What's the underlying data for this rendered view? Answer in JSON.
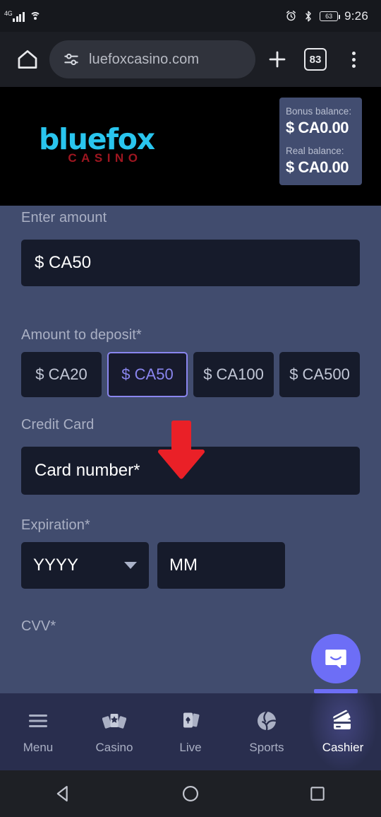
{
  "status_bar": {
    "network_type": "4G",
    "signal_icon": "signal-bars-icon",
    "wifi_icon": "wifi-icon",
    "alarm_icon": "alarm-icon",
    "bluetooth_icon": "bluetooth-icon",
    "battery_level": "63",
    "time": "9:26"
  },
  "browser": {
    "home_icon": "home-icon",
    "site_settings_icon": "tune-icon",
    "url": "luefoxcasino.com",
    "new_tab_icon": "plus-icon",
    "tab_count": "83",
    "menu_icon": "more-vertical-icon"
  },
  "site_header": {
    "logo_brand": "bluefox",
    "logo_sub": "CASINO",
    "balances": [
      {
        "label": "Bonus balance:",
        "value": "$ CA0.00"
      },
      {
        "label": "Real balance:",
        "value": "$ CA0.00"
      }
    ]
  },
  "form": {
    "enter_amount_label": "Enter amount",
    "enter_amount_value": "$ CA50",
    "amount_to_deposit_label": "Amount to deposit*",
    "deposit_chips": [
      {
        "label": "$ CA20",
        "selected": false
      },
      {
        "label": "$ CA50",
        "selected": true
      },
      {
        "label": "$ CA100",
        "selected": false
      },
      {
        "label": "$ CA500",
        "selected": false
      }
    ],
    "credit_card_label": "Credit Card",
    "card_number_placeholder": "Card number*",
    "expiration_label": "Expiration*",
    "expiration_year_value": "YYYY",
    "expiration_month_value": "MM",
    "cvv_label": "CVV*"
  },
  "annotation": {
    "arrow_icon": "down-arrow-icon",
    "arrow_color": "#ea2027"
  },
  "chat": {
    "icon": "chat-bubble-icon",
    "color": "#6d6ef6"
  },
  "bottom_nav": {
    "items": [
      {
        "label": "Menu",
        "icon": "hamburger-icon",
        "active": false
      },
      {
        "label": "Casino",
        "icon": "playing-cards-icon",
        "active": false
      },
      {
        "label": "Live",
        "icon": "card-deck-icon",
        "active": false
      },
      {
        "label": "Sports",
        "icon": "ball-icon",
        "active": false
      },
      {
        "label": "Cashier",
        "icon": "credit-card-icon",
        "active": true
      }
    ]
  },
  "android_nav": {
    "back_icon": "back-triangle-icon",
    "home_icon": "home-circle-icon",
    "recents_icon": "recents-square-icon"
  },
  "colors": {
    "page_bg": "#414c6e",
    "input_bg": "#161b2b",
    "accent_purple": "#8a86ef",
    "brand_cyan": "#29c5ee",
    "brand_red": "#9e1620",
    "nav_bg": "#292e4e"
  }
}
